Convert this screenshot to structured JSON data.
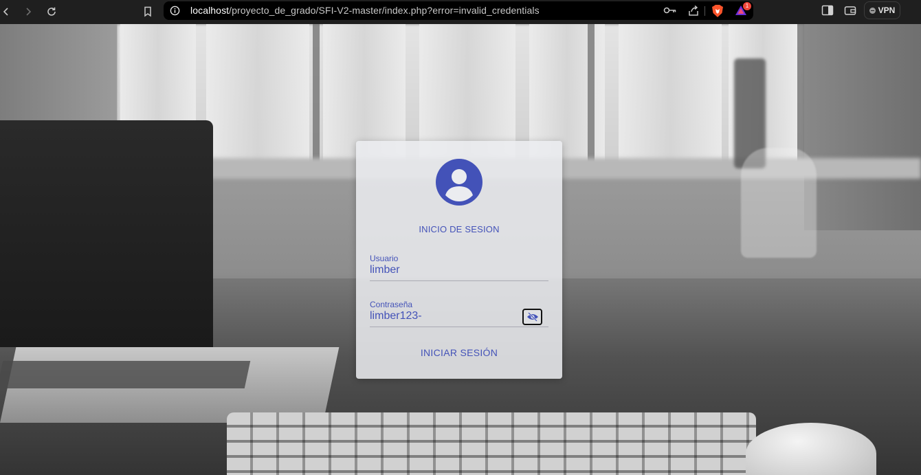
{
  "browser": {
    "url_host": "localhost",
    "url_path": "/proyecto_de_grado/SFI-V2-master/index.php?error=invalid_credentials",
    "rewards_badge": "1",
    "vpn_label": "VPN"
  },
  "login": {
    "title": "INICIO DE SESION",
    "username_label": "Usuario",
    "username_value": "limber",
    "password_label": "Contraseña",
    "password_value": "limber123-",
    "submit_label": "INICIAR SESIÓN"
  },
  "colors": {
    "accent": "#4352b8",
    "chrome": "#1f1f1f",
    "urlbar": "#000000"
  },
  "icons": [
    "back-icon",
    "forward-icon",
    "reload-icon",
    "bookmark-icon",
    "site-info-icon",
    "key-icon",
    "share-icon",
    "brave-shield-icon",
    "brave-rewards-icon",
    "sidebar-icon",
    "wallet-icon",
    "user-avatar-icon",
    "eye-slash-icon"
  ]
}
